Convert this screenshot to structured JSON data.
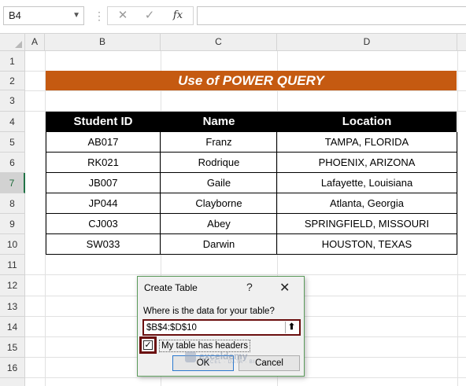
{
  "formula_bar": {
    "name_box": "B4",
    "cancel_icon": "✕",
    "enter_icon": "✓",
    "fx_label": "fx",
    "formula": ""
  },
  "columns": [
    "A",
    "B",
    "C",
    "D"
  ],
  "rows": [
    "1",
    "2",
    "3",
    "4",
    "5",
    "6",
    "7",
    "8",
    "9",
    "10",
    "11",
    "12",
    "13",
    "14",
    "15",
    "16"
  ],
  "banner_title": "Use of POWER QUERY",
  "table": {
    "headers": [
      "Student ID",
      "Name",
      "Location"
    ],
    "rows": [
      [
        "AB017",
        "Franz",
        "TAMPA, FLORIDA"
      ],
      [
        "RK021",
        "Rodrique",
        "PHOENIX, ARIZONA"
      ],
      [
        "JB007",
        "Gaile",
        "Lafayette, Louisiana"
      ],
      [
        "JP044",
        "Clayborne",
        "Atlanta, Georgia"
      ],
      [
        "CJ003",
        "Abey",
        "SPRINGFIELD, MISSOURI"
      ],
      [
        "SW033",
        "Darwin",
        "HOUSTON, TEXAS"
      ]
    ]
  },
  "dialog": {
    "title": "Create Table",
    "help": "?",
    "close": "✕",
    "prompt": "Where is the data for your table?",
    "range": "$B$4:$D$10",
    "headers_checked": true,
    "checkbox_label": "My table has headers",
    "ok_label": "OK",
    "cancel_label": "Cancel",
    "watermark_name": "exceldemy",
    "watermark_tag": "EXCEL · DATA · BI"
  },
  "colors": {
    "banner": "#c55a11",
    "table_header": "#000000",
    "highlight_border": "#6b0f0f",
    "selected_row_accent": "#217346"
  }
}
